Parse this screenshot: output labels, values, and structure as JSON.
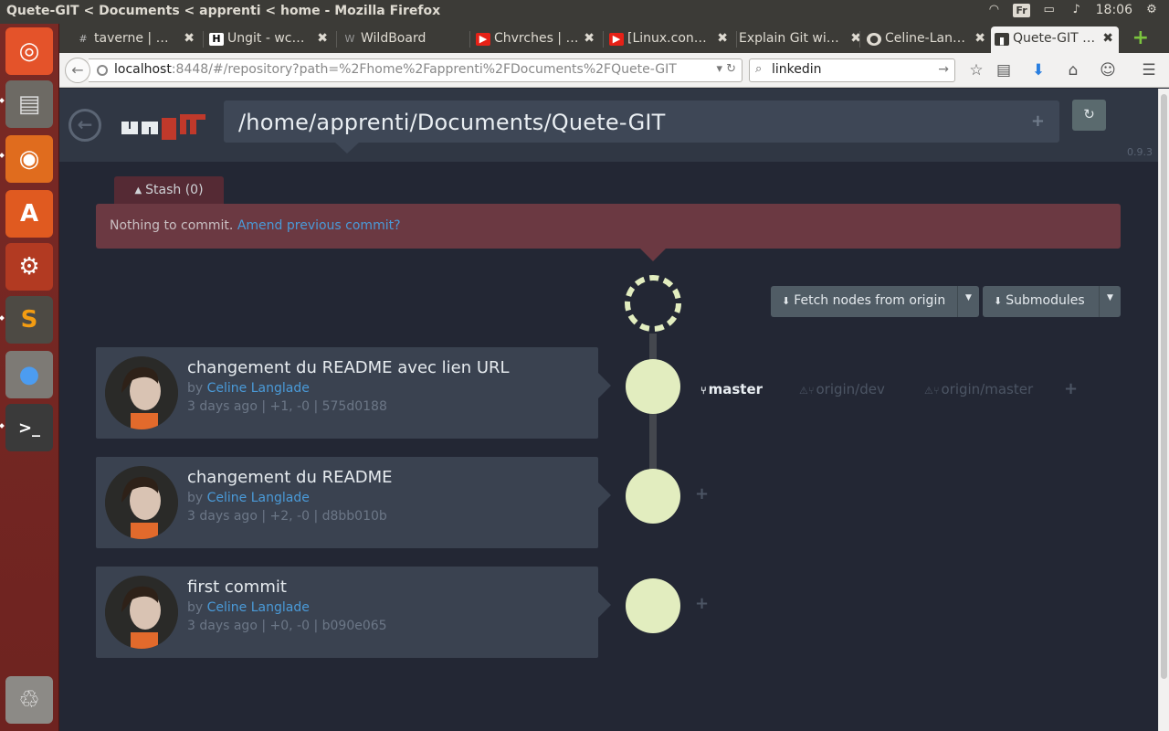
{
  "os": {
    "window_title": "Quete-GIT < Documents < apprenti < home - Mozilla Firefox",
    "keyboard_layout": "Fr",
    "clock": "18:06"
  },
  "browser": {
    "tabs": [
      {
        "label": "taverne | …",
        "icon": "hash-icon",
        "color": "#3c3b37"
      },
      {
        "label": "Ungit - wc…",
        "icon": "h-logo-icon",
        "color": "#ffffff"
      },
      {
        "label": "WildBoard",
        "icon": "wildboard-icon",
        "color": "#3c3b37"
      },
      {
        "label": "Chvrches | …",
        "icon": "youtube-icon",
        "color": "#e62117"
      },
      {
        "label": "[Linux.con…",
        "icon": "youtube-icon",
        "color": "#e62117"
      },
      {
        "label": "Explain Git wi…",
        "icon": "none",
        "color": "#3c3b37"
      },
      {
        "label": "Celine-Lan…",
        "icon": "github-icon",
        "color": "#3c3b37"
      },
      {
        "label": "Quete-GIT …",
        "icon": "ungit-icon",
        "color": "#f2f1f0"
      }
    ],
    "url_host": "localhost",
    "url_path": ":8448/#/repository?path=%2Fhome%2Fapprenti%2FDocuments%2FQuete-GIT",
    "search_value": "linkedin"
  },
  "ungit": {
    "logo_text": "ungit",
    "repo_path": "/home/apprenti/Documents/Quete-GIT",
    "version": "0.9.3",
    "stash_label": "Stash (0)",
    "banner_text": "Nothing to commit.",
    "amend_link": "Amend previous commit?",
    "fetch_button": "Fetch nodes from origin",
    "submodules_button": "Submodules",
    "branches": {
      "current": "master",
      "remote_dev": "origin/dev",
      "remote_master": "origin/master"
    },
    "commits": [
      {
        "title": "changement du README avec lien URL",
        "by": "by",
        "author": "Celine Langlade",
        "meta": "3 days ago | +1, -0 | 575d0188"
      },
      {
        "title": "changement du README",
        "by": "by",
        "author": "Celine Langlade",
        "meta": "3 days ago | +2, -0 | d8bb010b"
      },
      {
        "title": "first commit",
        "by": "by",
        "author": "Celine Langlade",
        "meta": "3 days ago | +0, -0 | b090e065"
      }
    ]
  },
  "colors": {
    "background": "#232734",
    "header": "#303744",
    "node": "#e2edbf",
    "banner": "#6b3942",
    "link": "#4a9ad8"
  }
}
